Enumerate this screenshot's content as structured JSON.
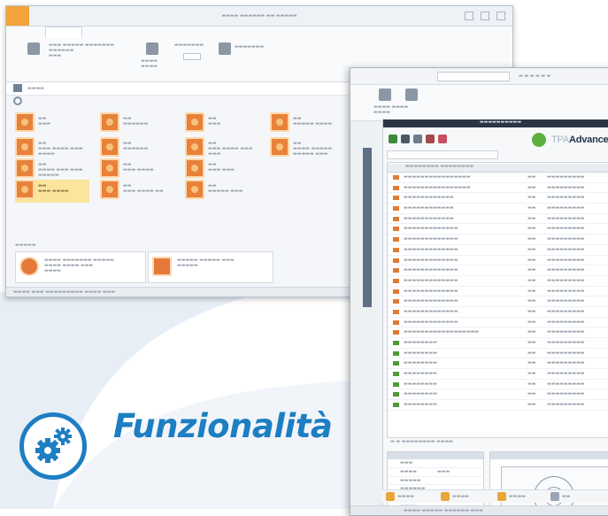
{
  "colors": {
    "brand_blue": "#1d7ec2",
    "background_swoosh": "#e7eef6",
    "tile_orange": "#e8813a",
    "selected_tile": "#fbe49b",
    "logo_green": "#5fb042"
  },
  "feature": {
    "icon": "gears-icon",
    "heading": "Funzionalità"
  },
  "window1": {
    "icons": [
      "app-menu-icon",
      "home-icon",
      "refresh-icon"
    ]
  },
  "window2": {
    "logo": {
      "icon": "green-circle-logo-icon",
      "prefix": "TPA",
      "brand": "Advanced"
    }
  }
}
